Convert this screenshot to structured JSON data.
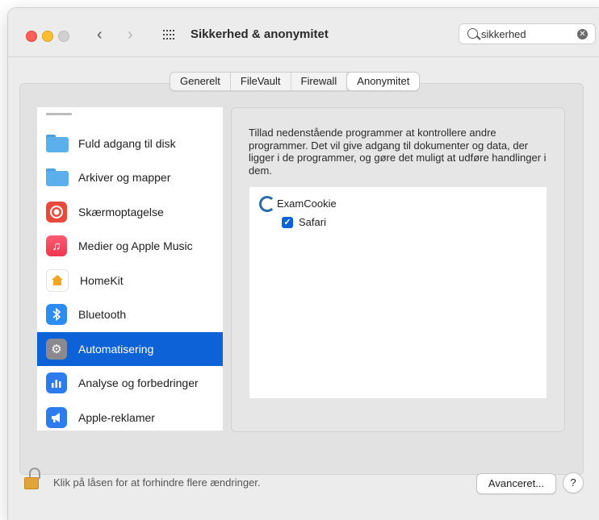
{
  "window": {
    "title": "Sikkerhed & anonymitet",
    "search_value": "sikkerhed"
  },
  "tabs": [
    {
      "label": "Generelt"
    },
    {
      "label": "FileVault"
    },
    {
      "label": "Firewall"
    },
    {
      "label": "Anonymitet",
      "active": true
    }
  ],
  "sidebar": {
    "items": [
      {
        "label": "Fuld adgang til disk",
        "icon": "folder-icon"
      },
      {
        "label": "Arkiver og mapper",
        "icon": "folder-icon"
      },
      {
        "label": "Skærmoptagelse",
        "icon": "screen-recording-icon"
      },
      {
        "label": "Medier og Apple Music",
        "icon": "music-note-icon"
      },
      {
        "label": "HomeKit",
        "icon": "home-icon"
      },
      {
        "label": "Bluetooth",
        "icon": "bluetooth-icon"
      },
      {
        "label": "Automatisering",
        "icon": "gear-icon",
        "selected": true
      },
      {
        "label": "Analyse og forbedringer",
        "icon": "analytics-icon"
      },
      {
        "label": "Apple-reklamer",
        "icon": "megaphone-icon"
      }
    ]
  },
  "panel": {
    "description": "Tillad nedenstående programmer at kontrollere andre programmer. Det vil give adgang til dokumenter og data, der ligger i de programmer, og gøre det muligt at udføre handlinger i dem.",
    "app": {
      "name": "ExamCookie",
      "icon": "examcookie-icon"
    },
    "child": {
      "name": "Safari",
      "checked": true
    }
  },
  "footer": {
    "lock_text": "Klik på låsen for at forhindre flere ændringer.",
    "advanced_label": "Avanceret...",
    "help_label": "?"
  },
  "colors": {
    "selection": "#0d62d8",
    "window_bg": "#ececec"
  }
}
